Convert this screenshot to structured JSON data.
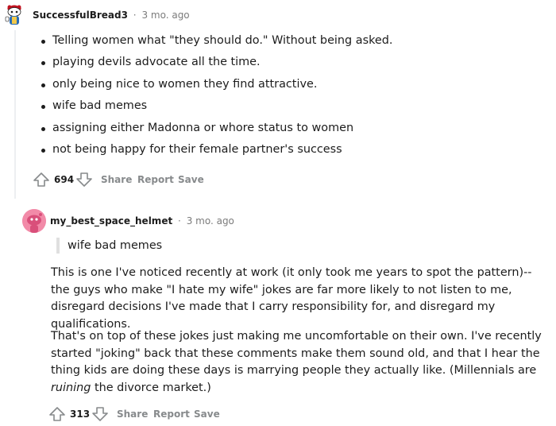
{
  "comments": [
    {
      "author": "SuccessfulBread3",
      "separator": "·",
      "time": "3 mo. ago",
      "bullets": [
        "Telling women what \"they should do.\" Without being asked.",
        "playing devils advocate all the time.",
        "only being nice to women they find attractive.",
        "wife bad memes",
        "assigning either Madonna or whore status to women",
        "not being happy for their female partner's success"
      ],
      "votes": "694",
      "share": "Share",
      "report": "Report",
      "save": "Save"
    },
    {
      "author": "my_best_space_helmet",
      "separator": "·",
      "time": "3 mo. ago",
      "quote": "wife bad memes",
      "p1": "This is one I've noticed recently at work (it only took me years to spot the pattern)-- the guys who make \"I hate my wife\" jokes are far more likely to not listen to me, disregard decisions I've made that I carry responsibility for, and disregard my qualifications.",
      "p2_before": "That's on top of these jokes just making me uncomfortable on their own. I've recently started \"joking\" back that these comments make them sound old, and that I hear the thing kids are doing these days is marrying people they actually like. (Millennials are ",
      "p2_em": "ruining",
      "p2_after": " the divorce market.)",
      "votes": "313",
      "share": "Share",
      "report": "Report",
      "save": "Save"
    }
  ],
  "icons": {
    "avatar1": "snoo-avatar-icon",
    "avatar2": "pink-snoo-avatar-icon",
    "upvote": "upvote-arrow-icon",
    "downvote": "downvote-arrow-icon"
  },
  "colors": {
    "meta": "#7c7c7c",
    "action": "#878a8c",
    "avatar2": "#f28aa8"
  }
}
